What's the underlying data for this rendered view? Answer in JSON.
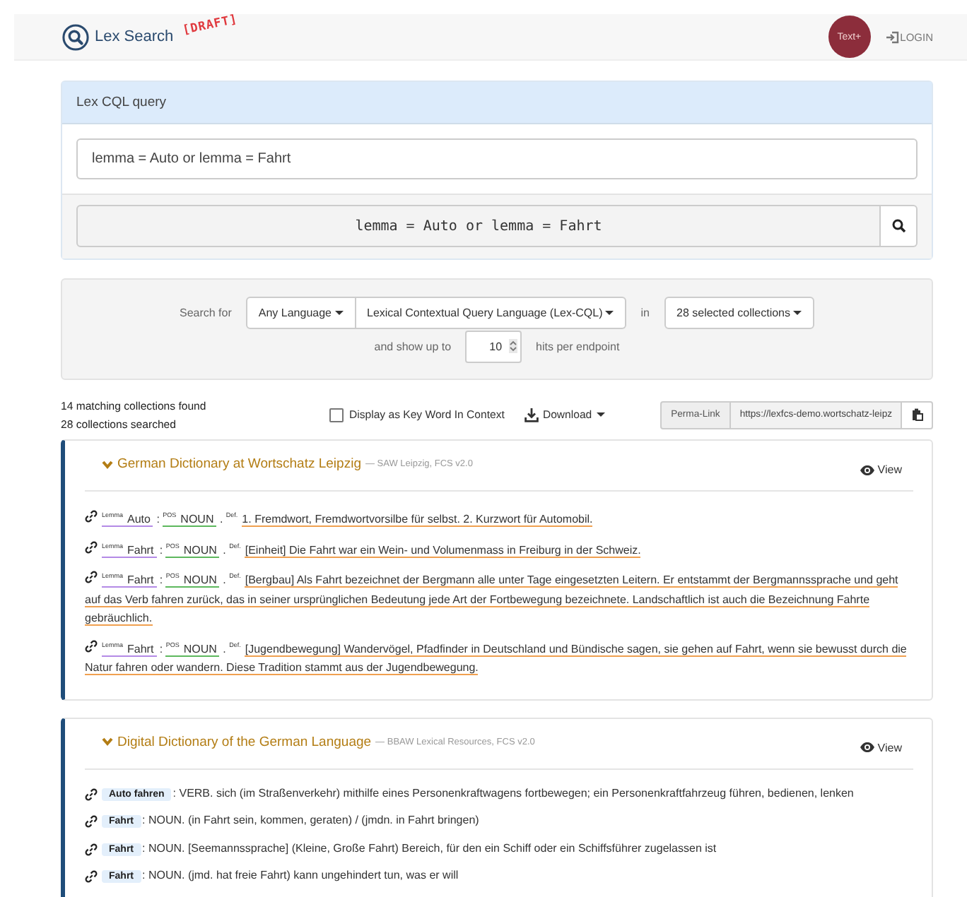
{
  "navbar": {
    "brand": "Lex Search",
    "stamp": "[DRAFT]",
    "badge": "Text+",
    "login": "LOGIN"
  },
  "query_panel": {
    "title": "Lex CQL query",
    "query_value": "lemma = Auto or lemma = Fahrt",
    "query_display": "lemma = Auto or lemma = Fahrt"
  },
  "options": {
    "search_for_label": "Search for",
    "language": "Any Language",
    "query_language": "Lexical Contextual Query Language (Lex-CQL)",
    "in_label": "in",
    "collections": "28 selected collections",
    "show_up_to_label": "and show up to",
    "hits_value": "10",
    "hits_label": "hits per endpoint"
  },
  "results_bar": {
    "matching": "14 matching collections found",
    "searched": "28 collections searched",
    "kwic": {
      "label": "Display as Key Word In Context",
      "checked": false
    },
    "download": "Download",
    "permalink_label": "Perma-Link",
    "permalink_value": "https://lexfcs-demo.wortschatz-leipz"
  },
  "collections": [
    {
      "title": "German Dictionary at Wortschatz Leipzig",
      "meta": "— SAW Leipzig, FCS v2.0",
      "view": "View",
      "expanded": true,
      "results": [
        {
          "kind": "lex",
          "lemma_label": "Lemma",
          "lemma": "Auto",
          "colon": ":",
          "pos_label": "POS",
          "pos": "NOUN",
          "period": ".",
          "def_label": "Def.",
          "definition": "1. Fremdwort, Fremdwortvorsilbe für selbst. 2. Kurzwort für Automobil."
        },
        {
          "kind": "lex",
          "lemma_label": "Lemma",
          "lemma": "Fahrt",
          "colon": ":",
          "pos_label": "POS",
          "pos": "NOUN",
          "period": ".",
          "def_label": "Def.",
          "definition": "[Einheit] Die Fahrt war ein Wein- und Volumenmass in Freiburg in der Schweiz."
        },
        {
          "kind": "lex",
          "lemma_label": "Lemma",
          "lemma": "Fahrt",
          "colon": ":",
          "pos_label": "POS",
          "pos": "NOUN",
          "period": ".",
          "def_label": "Def.",
          "definition": "[Bergbau] Als Fahrt bezeichnet der Bergmann alle unter Tage eingesetzten Leitern. Er entstammt der Bergmannssprache und geht auf das Verb fahren zurück, das in seiner ursprünglichen Bedeutung jede Art der Fortbewegung bezeichnete. Landschaftlich ist auch die Bezeichnung Fahrte gebräuchlich."
        },
        {
          "kind": "lex",
          "lemma_label": "Lemma",
          "lemma": "Fahrt",
          "colon": ":",
          "pos_label": "POS",
          "pos": "NOUN",
          "period": ".",
          "def_label": "Def.",
          "definition": "[Jugendbewegung] Wandervögel, Pfadfinder in Deutschland und Bündische sagen, sie gehen auf Fahrt, wenn sie bewusst durch die Natur fahren oder wandern. Diese Tradition stammt aus der Jugendbewegung."
        }
      ]
    },
    {
      "title": "Digital Dictionary of the German Language",
      "meta": "— BBAW Lexical Resources, FCS v2.0",
      "view": "View",
      "expanded": true,
      "results": [
        {
          "kind": "plain",
          "badge": "Auto fahren",
          "text": ": VERB. sich (im Straßenverkehr) mithilfe eines Personenkraftwagens fortbewegen; ein Personenkraftfahrzeug führen, bedienen, lenken"
        },
        {
          "kind": "plain",
          "badge": "Fahrt",
          "text": ": NOUN. (in Fahrt sein, kommen, geraten) / (jmdn. in Fahrt bringen)"
        },
        {
          "kind": "plain",
          "badge": "Fahrt",
          "text": ": NOUN. [Seemannssprache] (Kleine, Große Fahrt) Bereich, für den ein Schiff oder ein Schiffsführer zugelassen ist"
        },
        {
          "kind": "plain",
          "badge": "Fahrt",
          "text": ": NOUN. (jmd. hat freie Fahrt) kann ungehindert tun, was er will"
        }
      ]
    }
  ]
}
